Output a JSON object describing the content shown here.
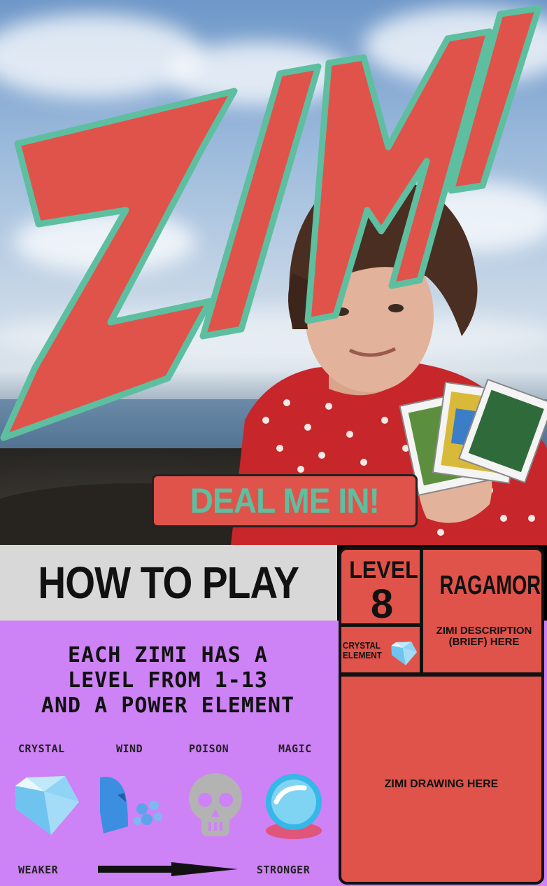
{
  "hero": {
    "logo_text": "ZIMI",
    "cta_label": "DEAL ME IN!",
    "colors": {
      "logo_fill": "#e0534a",
      "logo_outline": "#5dbfa0",
      "cta_bg": "#e0534a",
      "cta_text": "#5dbfa0"
    }
  },
  "howto": {
    "title": "HOW TO PLAY",
    "rules": [
      "EACH ZIMI HAS A",
      "LEVEL FROM 1-13",
      "AND A POWER ELEMENT"
    ],
    "elements": [
      {
        "label": "CRYSTAL",
        "icon": "crystal-icon"
      },
      {
        "label": "WIND",
        "icon": "wind-icon"
      },
      {
        "label": "POISON",
        "icon": "poison-skull-icon"
      },
      {
        "label": "MAGIC",
        "icon": "magic-orb-icon"
      }
    ],
    "scale": {
      "weaker": "WEAKER",
      "stronger": "STRONGER"
    },
    "colors": {
      "header_bg": "#d8d8d8",
      "body_bg": "#cd82f5"
    }
  },
  "card": {
    "level_word": "LEVEL",
    "level_number": "8",
    "element_line1": "CRYSTAL",
    "element_line2": "ELEMENT",
    "element_icon": "crystal-icon",
    "name": "RAGAMORPH",
    "description_line1": "ZIMI DESCRIPTION",
    "description_line2": "(BRIEF) HERE",
    "drawing_placeholder": "ZIMI DRAWING HERE",
    "colors": {
      "card_bg": "#e0534a",
      "border": "#111111"
    }
  }
}
